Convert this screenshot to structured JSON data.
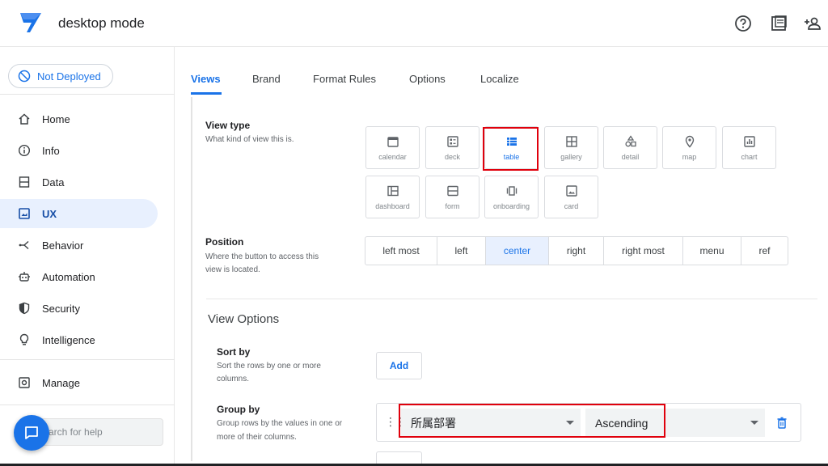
{
  "header": {
    "app_title": "desktop mode",
    "icons": [
      "help-icon",
      "docs-icon",
      "add-person-icon"
    ],
    "brand_color": "#1a73e8"
  },
  "sidebar": {
    "deploy_status": "Not Deployed",
    "items": [
      {
        "label": "Home",
        "icon": "home-icon"
      },
      {
        "label": "Info",
        "icon": "info-icon"
      },
      {
        "label": "Data",
        "icon": "data-icon"
      },
      {
        "label": "UX",
        "icon": "ux-icon",
        "active": true
      },
      {
        "label": "Behavior",
        "icon": "behavior-icon"
      },
      {
        "label": "Automation",
        "icon": "automation-icon"
      },
      {
        "label": "Security",
        "icon": "shield-icon"
      },
      {
        "label": "Intelligence",
        "icon": "lightbulb-icon"
      }
    ],
    "manage": {
      "label": "Manage",
      "icon": "manage-icon"
    },
    "help_search_placeholder": "arch for help"
  },
  "tabs": [
    "Views",
    "Brand",
    "Format Rules",
    "Options",
    "Localize"
  ],
  "view_type": {
    "title": "View type",
    "description": "What kind of view this is.",
    "options": [
      "calendar",
      "deck",
      "table",
      "gallery",
      "detail",
      "map",
      "chart",
      "dashboard",
      "form",
      "onboarding",
      "card"
    ],
    "selected": "table"
  },
  "position": {
    "title": "Position",
    "description_line1": "Where the button to access this",
    "description_line2": "view is located.",
    "options": [
      "left most",
      "left",
      "center",
      "right",
      "right most",
      "menu",
      "ref"
    ],
    "selected": "center"
  },
  "view_options": {
    "heading": "View Options",
    "sort_by": {
      "title": "Sort by",
      "description_line1": "Sort the rows by one or more",
      "description_line2": "columns.",
      "add_label": "Add"
    },
    "group_by": {
      "title": "Group by",
      "description_line1": "Group rows by the values in one or",
      "description_line2": "more of their columns.",
      "column_value": "所属部署",
      "order_value": "Ascending"
    }
  },
  "highlight_color": "#e0000c"
}
